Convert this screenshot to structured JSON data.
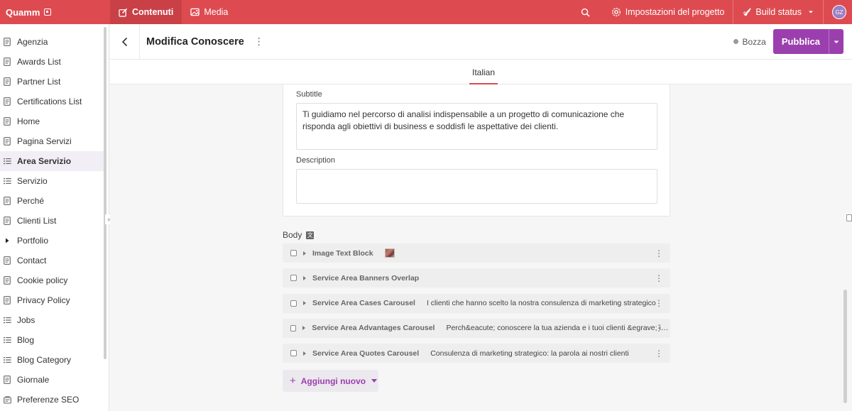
{
  "topbar": {
    "brand": "Quamm",
    "tabs": [
      {
        "label": "Contenuti",
        "icon": "edit-icon",
        "active": true
      },
      {
        "label": "Media",
        "icon": "image-icon",
        "active": false
      }
    ],
    "settings_label": "Impostazioni del progetto",
    "build_label": "Build status",
    "avatar_initials": "GZ"
  },
  "sidebar": {
    "items": [
      {
        "label": "Agenzia",
        "icon": "page-icon"
      },
      {
        "label": "Awards List",
        "icon": "page-icon"
      },
      {
        "label": "Partner List",
        "icon": "page-icon"
      },
      {
        "label": "Certifications List",
        "icon": "page-icon"
      },
      {
        "label": "Home",
        "icon": "page-icon"
      },
      {
        "label": "Pagina Servizi",
        "icon": "page-icon"
      },
      {
        "label": "Area Servizio",
        "icon": "list-icon",
        "active": true
      },
      {
        "label": "Servizio",
        "icon": "list-icon"
      },
      {
        "label": "Perché",
        "icon": "page-icon"
      },
      {
        "label": "Clienti List",
        "icon": "page-icon"
      },
      {
        "label": "Portfolio",
        "icon": "caret-right-icon"
      },
      {
        "label": "Contact",
        "icon": "page-icon"
      },
      {
        "label": "Cookie policy",
        "icon": "page-icon"
      },
      {
        "label": "Privacy Policy",
        "icon": "page-icon"
      },
      {
        "label": "Jobs",
        "icon": "list-icon"
      },
      {
        "label": "Blog",
        "icon": "list-icon"
      },
      {
        "label": "Blog Category",
        "icon": "list-icon"
      },
      {
        "label": "Giornale",
        "icon": "page-icon"
      },
      {
        "label": "Preferenze SEO",
        "icon": "seo-icon"
      }
    ]
  },
  "header": {
    "title": "Modifica Conoscere",
    "status": "Bozza",
    "publish_label": "Pubblica"
  },
  "language_tab": "Italian",
  "form": {
    "subtitle_label": "Subtitle",
    "subtitle_value": "Ti guidiamo nel percorso di analisi indispensabile a un progetto di comunicazione che risponda agli obiettivi di business e soddisfi le aspettative dei clienti.",
    "description_label": "Description",
    "description_value": "",
    "body_label": "Body"
  },
  "blocks": [
    {
      "name": "Image Text Block",
      "desc": "",
      "has_thumb": true
    },
    {
      "name": "Service Area Banners Overlap",
      "desc": "",
      "has_thumb": false
    },
    {
      "name": "Service Area Cases Carousel",
      "desc": "I clienti che hanno scelto la nostra consulenza di marketing strategico",
      "has_thumb": false
    },
    {
      "name": "Service Area Advantages Carousel",
      "desc": "Perch&eacute; conoscere la tua azienda e i tuoi clienti &egrave; importante",
      "has_thumb": false
    },
    {
      "name": "Service Area Quotes Carousel",
      "desc": "Consulenza di marketing strategico: la parola ai nostri clienti",
      "has_thumb": false
    }
  ],
  "add_new_label": "Aggiungi nuovo",
  "colors": {
    "brand_red": "#dd4b50",
    "publish_purple": "#9b3fae"
  }
}
